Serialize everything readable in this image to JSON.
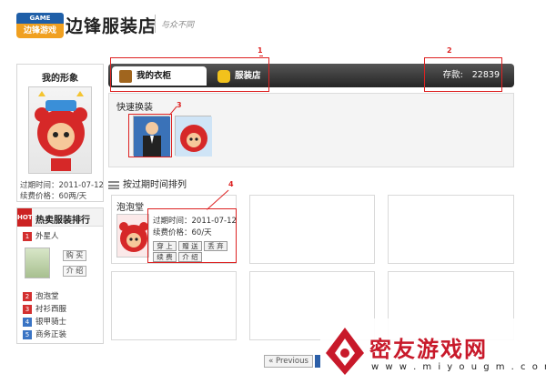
{
  "header": {
    "logo_top": "GAME",
    "logo_main": "边锋游戏",
    "title": "边锋服装店",
    "slogan": "与众不同"
  },
  "profile": {
    "title": "我的形象",
    "expire": "过期时间：2011-07-12",
    "price": "续费价格：60两/天"
  },
  "hot_rank": {
    "tag": "HOT",
    "title": "热卖服装排行",
    "top_item": {
      "num": "1",
      "label": "外星人"
    },
    "buy_label": "购 买",
    "intro_label": "介 绍",
    "items": [
      {
        "num": "2",
        "label": "泡泡堂"
      },
      {
        "num": "3",
        "label": "衬衫西服"
      },
      {
        "num": "4",
        "label": "银甲骑士"
      },
      {
        "num": "5",
        "label": "商务正装"
      }
    ]
  },
  "tabs": {
    "wardrobe": "我的衣柜",
    "shop": "服装店"
  },
  "deposit": {
    "label": "存款:",
    "amount": "22839"
  },
  "quick_change": {
    "title": "快速换装"
  },
  "sort": {
    "label": "按过期时间排列"
  },
  "item_card": {
    "title": "泡泡堂",
    "expire": "过期时间：2011-07-12",
    "price": "续费价格：60/天",
    "actions": [
      "穿 上",
      "赠 送",
      "丢 弃",
      "续 费",
      "介 绍"
    ]
  },
  "annotations": [
    "1",
    "2",
    "3",
    "4"
  ],
  "pager": {
    "previous": "« Previous"
  },
  "watermark": {
    "name": "密友游戏网",
    "url": "w w w . m i y o u g m . c o m"
  },
  "colors": {
    "tab_bar": "#262626",
    "annotation": "#dd2222",
    "watermark": "#c8192a"
  }
}
